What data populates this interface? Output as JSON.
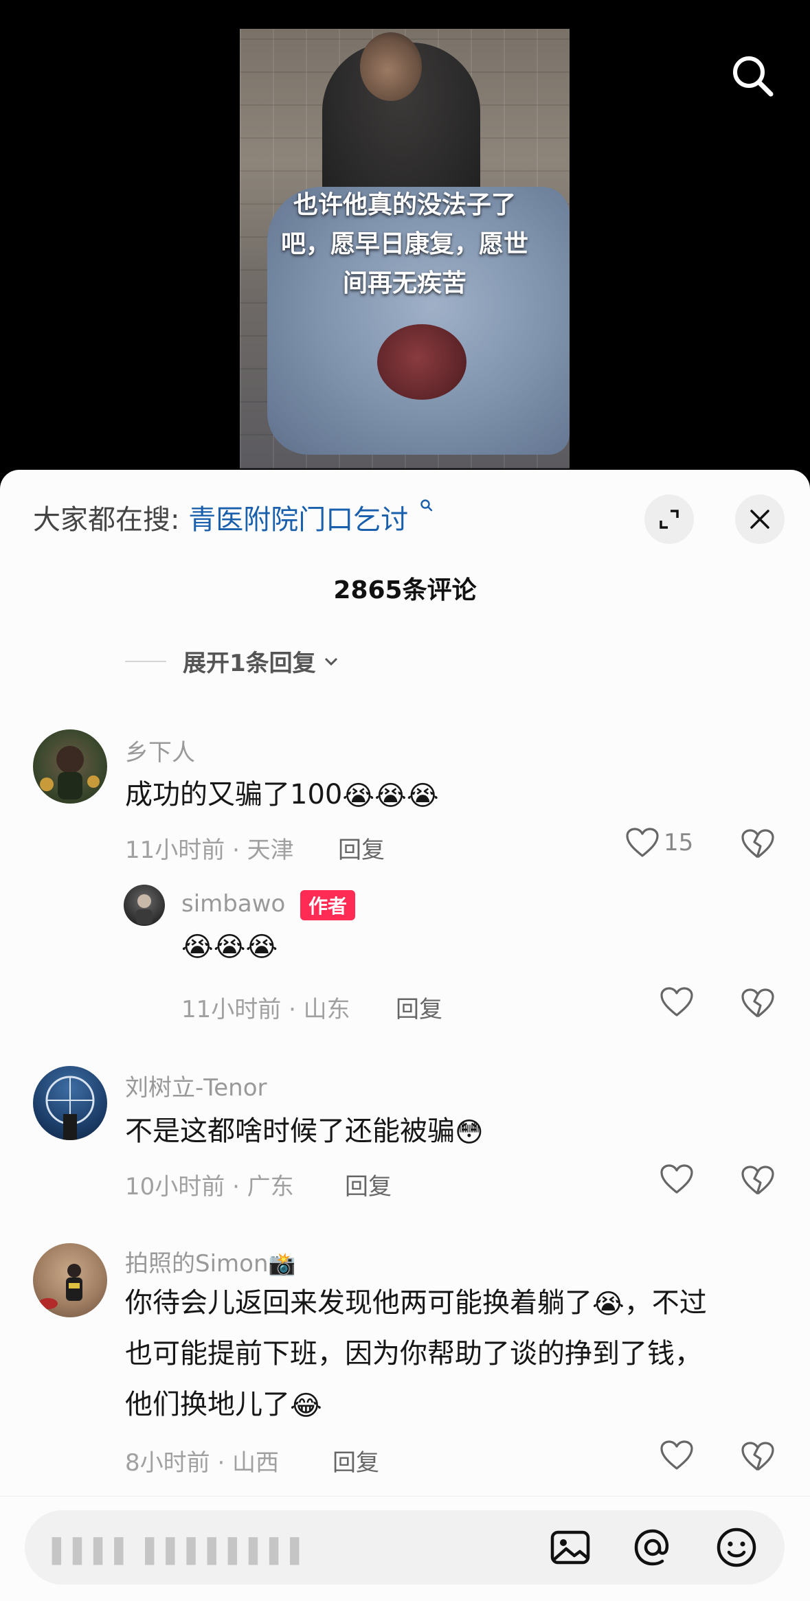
{
  "video": {
    "caption_lines": [
      "也许他真的没法子了",
      "吧，愿早日康复，愿世",
      "间再无疾苦"
    ]
  },
  "sheet": {
    "search_label": "大家都在搜:",
    "search_query": "青医附院门口乞讨",
    "comment_count": "2865条评论",
    "expand_replies": "展开1条回复"
  },
  "comments": [
    {
      "username": "乡下人",
      "text": "成功的又骗了100",
      "emojis": [
        "😭",
        "😭",
        "😭"
      ],
      "time_location": "11小时前 · 天津",
      "reply_label": "回复",
      "likes": "15"
    },
    {
      "username": "simbawo",
      "badge": "作者",
      "emojis": [
        "😭",
        "😭",
        "😭"
      ],
      "time_location": "11小时前 · 山东",
      "reply_label": "回复"
    },
    {
      "username": "刘树立-Tenor",
      "text": "不是这都啥时候了还能被骗",
      "emojis": [
        "😳"
      ],
      "time_location": "10小时前 · 广东",
      "reply_label": "回复"
    },
    {
      "username": "拍照的Simon",
      "username_emoji": "📸",
      "text_line1_a": "你待会儿返回来发现他两可能换着躺了",
      "line1_emoji": "😭",
      "text_line1_b": "，不过",
      "text_line2": "也可能提前下班，因为你帮助了谈的挣到了钱，",
      "text_line3": "他们换地儿了",
      "line3_emoji": "😂",
      "time_location": "8小时前 · 山西",
      "reply_label": "回复"
    }
  ],
  "input": {
    "placeholder": "▌▌▌▌ ▌▌▌▌▌▌▌▌"
  },
  "colors": {
    "link": "#1a5fab",
    "badge": "#fe2c55"
  },
  "icons": [
    "search-icon",
    "expand-icon",
    "close-icon",
    "heart-icon",
    "broken-heart-icon",
    "image-icon",
    "at-icon",
    "emoji-icon"
  ]
}
